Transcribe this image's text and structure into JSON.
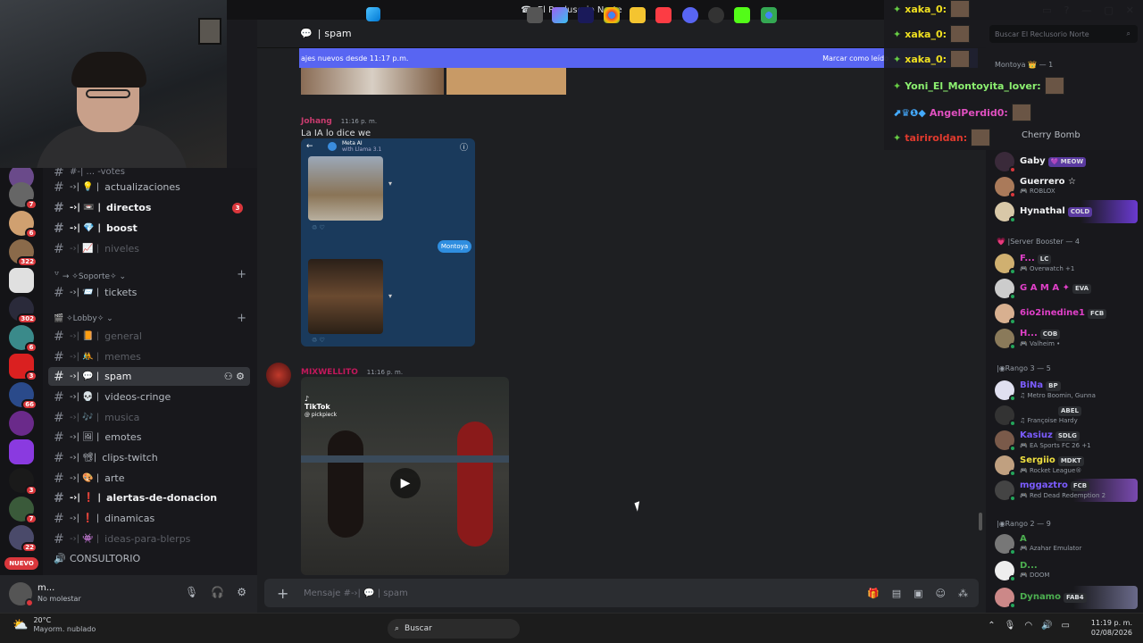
{
  "window": {
    "title": "El Reclusorio Norte"
  },
  "channel_header": {
    "name": "spam",
    "pre": "|"
  },
  "new_messages_bar": {
    "text": "ajes nuevos desde 11:17 p.m.",
    "mark": "Marcar como leído"
  },
  "channels": {
    "partial_top": "#-| ... -votes",
    "items": [
      {
        "name": "actualizaciones",
        "pre": "-›| 💡 |",
        "state": "muted"
      },
      {
        "name": "directos",
        "pre": "-›| 📼 |",
        "state": "unread",
        "badge": "3"
      },
      {
        "name": "boost",
        "pre": "-›| 💎 |",
        "state": "unread"
      },
      {
        "name": "niveles",
        "pre": "-›| 📈 |",
        "state": "muted"
      },
      {
        "name": "tickets",
        "pre": "-›| 📨 |",
        "state": "normal"
      },
      {
        "name": "general",
        "pre": "-›| 📙 |",
        "state": "muted"
      },
      {
        "name": "memes",
        "pre": "-›| 🤼 |",
        "state": "muted"
      },
      {
        "name": "spam",
        "pre": "-›| 💬 |",
        "state": "selected"
      },
      {
        "name": "videos-cringe",
        "pre": "-›| 💀 |",
        "state": "normal"
      },
      {
        "name": "musica",
        "pre": "-›| 🎶 |",
        "state": "muted"
      },
      {
        "name": "emotes",
        "pre": "-›| 🖼 |",
        "state": "normal"
      },
      {
        "name": "clips-twitch",
        "pre": "-›| 📽|",
        "state": "normal"
      },
      {
        "name": "arte",
        "pre": "-›| 🎨 |",
        "state": "normal"
      },
      {
        "name": "alertas-de-donacion",
        "pre": "-›| ❗ |",
        "state": "unread"
      },
      {
        "name": "dinamicas",
        "pre": "-›| ❗ |",
        "state": "normal"
      },
      {
        "name": "ideas-para-blerps",
        "pre": "-›| 👾 |",
        "state": "muted"
      }
    ],
    "categories": [
      {
        "label": "꒷ → ✧Soporte✧ ⌄"
      },
      {
        "label": "🎬 ✧Lobby✧ ⌄"
      }
    ],
    "voice": {
      "label": "CONSULTORIO"
    }
  },
  "servers": {
    "badges": [
      "7",
      "6",
      "322",
      "302",
      "6",
      "3",
      "66",
      "3",
      "3",
      "7",
      "22"
    ],
    "nuevo": "NUEVO"
  },
  "user": {
    "name": "m...",
    "status": "No molestar"
  },
  "messages": [
    {
      "author": "Johang",
      "time": "11:16 p. m.",
      "text": "La IA lo dice we",
      "color": "#c93b6e"
    },
    {
      "author": "MIXWELLITO",
      "time": "11:16 p. m.",
      "text": "",
      "color": "#c2185b"
    }
  ],
  "embed_meta": {
    "title": "Meta AI",
    "subtitle": "with Llama 3.1",
    "chip": "Montoya"
  },
  "tiktok": {
    "label": "TikTok",
    "handle": "@ pickpieck"
  },
  "composer": {
    "placeholder": "Mensaje #-›| 💬 | spam"
  },
  "search": {
    "placeholder": "Buscar El Reclusorio Norte"
  },
  "stream_chat": [
    {
      "user": "xaka_0:",
      "color": "#f0e020"
    },
    {
      "user": "xaka_0:",
      "color": "#f0e020"
    },
    {
      "user": "xaka_0:",
      "color": "#f0e020"
    },
    {
      "user": "Yoni_El_Montoyita_lover:",
      "color": "#8cf070"
    },
    {
      "user": "AngelPerdid0:",
      "color": "#e050c0"
    },
    {
      "user": "tairiroldan:",
      "color": "#e03a2e"
    }
  ],
  "members": {
    "group_top": "Montoya 👑 — 1",
    "cherry": "Cherry Bomb",
    "list": [
      {
        "name": "Gaby",
        "tag": "💜 MEOW",
        "activity": "",
        "color": "#f2f3f5"
      },
      {
        "name": "Guerrero ☆",
        "tag": "",
        "activity": "🎮 ROBLOX",
        "color": "#f2f3f5"
      },
      {
        "name": "Hynathal",
        "tag": "COLD",
        "activity": "",
        "color": "#f2f3f5"
      },
      {
        "name": "F...",
        "tag": "LC",
        "activity": "🎮 Overwatch +1",
        "color": "#e040c8"
      },
      {
        "name": "G A M A ✦",
        "tag": "EVA",
        "activity": "",
        "color": "#e040c8"
      },
      {
        "name": "6io2inedine1",
        "tag": "FCB",
        "activity": "",
        "color": "#e040c8"
      },
      {
        "name": "H...",
        "tag": "COB",
        "activity": "🎮 Valheim •",
        "color": "#e040c8"
      },
      {
        "name": "BiNa",
        "tag": "BP",
        "activity": "♫ Metro Boomin, Gunna",
        "color": "#7b5cff"
      },
      {
        "name": "",
        "tag": "ABEL",
        "activity": "♫ Françoise Hardy",
        "color": "#7b5cff"
      },
      {
        "name": "Kasiuz",
        "tag": "SDLG",
        "activity": "🎮 EA Sports FC 26 +1",
        "color": "#7b5cff"
      },
      {
        "name": "Sergiio",
        "tag": "MDKT",
        "activity": "🎮 Rocket League®",
        "color": "#f0e040"
      },
      {
        "name": "mggaztro",
        "tag": "FCB",
        "activity": "🎮 Red Dead Redemption 2",
        "color": "#7b5cff"
      },
      {
        "name": "A",
        "tag": "",
        "activity": "🎮 Azahar Emulator",
        "color": "#4caf50"
      },
      {
        "name": "D...",
        "tag": "",
        "activity": "🎮 DOOM",
        "color": "#4caf50"
      },
      {
        "name": "Dynamo",
        "tag": "FAB4",
        "activity": "",
        "color": "#4caf50"
      }
    ],
    "groups": [
      {
        "label": "💗 |Server Booster — 4"
      },
      {
        "label": "|◉Rango 3 — 5"
      },
      {
        "label": "|◉Rango 2 — 9"
      }
    ]
  },
  "taskbar": {
    "weather_temp": "20°C",
    "weather_desc": "Mayorm. nublado",
    "search": "Buscar",
    "time": "11:19 p. m.",
    "date": "02/08/2026"
  }
}
